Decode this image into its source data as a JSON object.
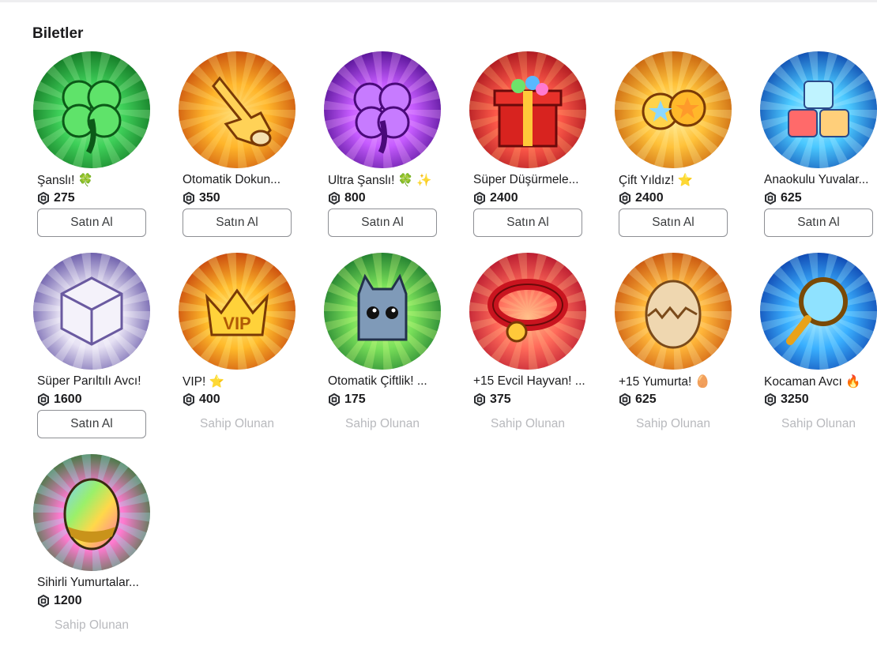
{
  "section": {
    "title": "Biletler"
  },
  "labels": {
    "buy": "Satın Al",
    "owned": "Sahip Olunan"
  },
  "items": [
    {
      "name": "Şanslı! 🍀",
      "price": "275",
      "owned": false,
      "icon": "four-leaf-clover-icon",
      "colors": [
        "#3fd15a",
        "#0f6e1f",
        "#a6f0a0"
      ]
    },
    {
      "name": "Otomatik Dokun...",
      "price": "350",
      "owned": false,
      "icon": "tap-hand-icon",
      "colors": [
        "#ffb52a",
        "#c4460a",
        "#ffe07a"
      ]
    },
    {
      "name": "Ultra Şanslı! 🍀 ✨",
      "price": "800",
      "owned": false,
      "icon": "purple-clover-icon",
      "colors": [
        "#c65cff",
        "#4a0a8a",
        "#f0b0ff"
      ]
    },
    {
      "name": "Süper Düşürmele...",
      "price": "2400",
      "owned": false,
      "icon": "gift-box-icon",
      "colors": [
        "#ff5a4a",
        "#a1101a",
        "#ffb070"
      ]
    },
    {
      "name": "Çift Yıldız! ⭐",
      "price": "2400",
      "owned": false,
      "icon": "double-star-icon",
      "colors": [
        "#ffc23a",
        "#c2590a",
        "#fff1a0"
      ]
    },
    {
      "name": "Anaokulu Yuvalar...",
      "price": "625",
      "owned": false,
      "icon": "blocks-icon",
      "colors": [
        "#4ac8ff",
        "#0a3fa8",
        "#b9f2ff"
      ]
    },
    {
      "name": "Süper Parıltılı Avcı!",
      "price": "1600",
      "owned": false,
      "icon": "shiny-dice-icon",
      "colors": [
        "#e7e2f4",
        "#5a4aa0",
        "#ffffff"
      ]
    },
    {
      "name": "VIP! ⭐",
      "price": "400",
      "owned": true,
      "icon": "vip-crown-icon",
      "colors": [
        "#ffba2a",
        "#c23a0a",
        "#fff08a"
      ]
    },
    {
      "name": "Otomatik Çiftlik! ...",
      "price": "175",
      "owned": true,
      "icon": "robot-cat-icon",
      "colors": [
        "#7ae05a",
        "#16732a",
        "#d9ff8a"
      ]
    },
    {
      "name": "+15 Evcil Hayvan! ...",
      "price": "375",
      "owned": true,
      "icon": "pet-collar-icon",
      "colors": [
        "#ff6a5a",
        "#b0102a",
        "#ffc08a"
      ]
    },
    {
      "name": "+15 Yumurta! 🥚",
      "price": "625",
      "owned": true,
      "icon": "cracked-egg-icon",
      "colors": [
        "#ffb63a",
        "#c24a0a",
        "#ffe7a0"
      ]
    },
    {
      "name": "Kocaman Avcı 🔥",
      "price": "3250",
      "owned": true,
      "icon": "magnifier-icon",
      "colors": [
        "#3ab0ff",
        "#0a3aa8",
        "#a8ecff"
      ]
    },
    {
      "name": "Sihirli Yumurtalar...",
      "price": "1200",
      "owned": true,
      "icon": "rainbow-egg-icon",
      "colors": [
        "#ff7ad0",
        "#2a7a30",
        "#9af0ff"
      ]
    }
  ]
}
